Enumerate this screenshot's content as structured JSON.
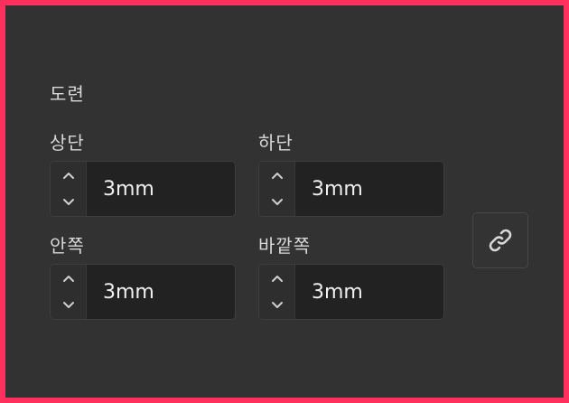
{
  "section": {
    "title": "도련"
  },
  "fields": {
    "top": {
      "label": "상단",
      "value": "3mm"
    },
    "bottom": {
      "label": "하단",
      "value": "3mm"
    },
    "inside": {
      "label": "안쪽",
      "value": "3mm"
    },
    "outside": {
      "label": "바깥쪽",
      "value": "3mm"
    }
  },
  "icons": {
    "increment": "chevron-up-icon",
    "decrement": "chevron-down-icon",
    "link": "link-icon"
  },
  "colors": {
    "frame": "#ff2f5e",
    "panel": "#323232",
    "input_bg": "#222222",
    "text": "#d8d8d8"
  }
}
